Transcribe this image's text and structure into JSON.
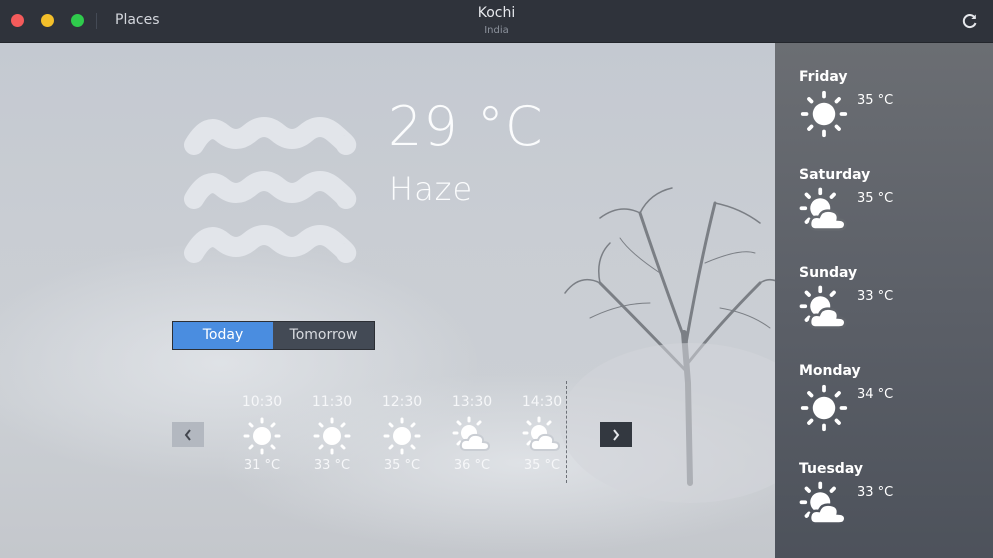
{
  "titlebar": {
    "places_label": "Places",
    "city": "Kochi",
    "country": "India",
    "refresh_icon": "refresh-icon"
  },
  "current": {
    "temperature": "29 °C",
    "condition": "Haze",
    "icon": "haze-icon"
  },
  "tabs": [
    {
      "label": "Today",
      "selected": true
    },
    {
      "label": "Tomorrow",
      "selected": false
    }
  ],
  "hourly": [
    {
      "time": "10:30",
      "temp": "31 °C",
      "icon": "sun-icon"
    },
    {
      "time": "11:30",
      "temp": "33 °C",
      "icon": "sun-icon"
    },
    {
      "time": "12:30",
      "temp": "35 °C",
      "icon": "sun-icon"
    },
    {
      "time": "13:30",
      "temp": "36 °C",
      "icon": "partly-cloudy-icon"
    },
    {
      "time": "14:30",
      "temp": "35 °C",
      "icon": "partly-cloudy-icon"
    }
  ],
  "forecast": [
    {
      "day": "Friday",
      "temp": "35 °C",
      "icon": "sun-icon"
    },
    {
      "day": "Saturday",
      "temp": "35 °C",
      "icon": "partly-cloudy-icon"
    },
    {
      "day": "Sunday",
      "temp": "33 °C",
      "icon": "partly-cloudy-icon"
    },
    {
      "day": "Monday",
      "temp": "34 °C",
      "icon": "sun-icon"
    },
    {
      "day": "Tuesday",
      "temp": "33 °C",
      "icon": "partly-cloudy-icon"
    }
  ],
  "colors": {
    "accent": "#4a8de0",
    "titlebar": "#2f333b",
    "sidebar": "#5c6068"
  }
}
